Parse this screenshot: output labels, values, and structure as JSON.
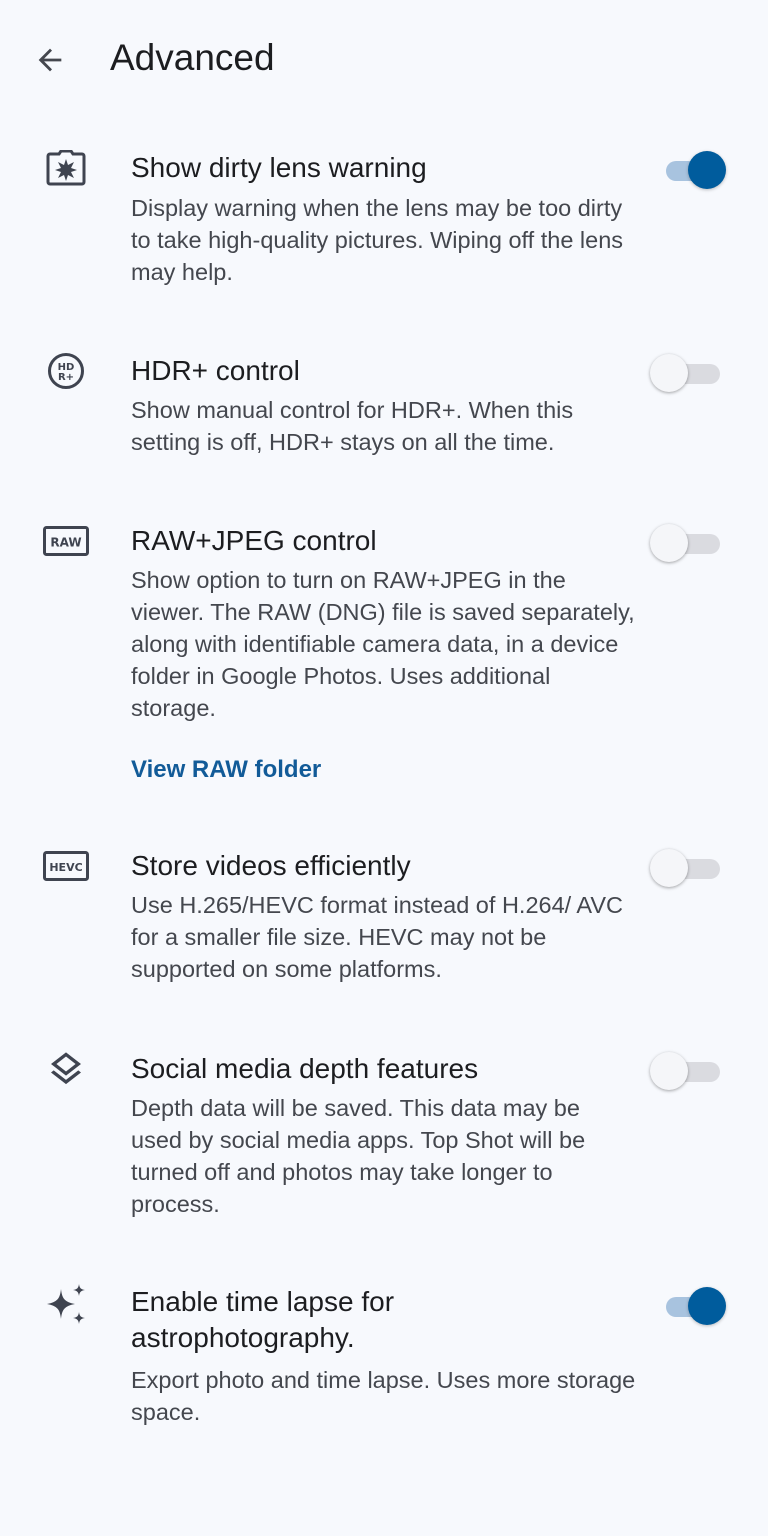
{
  "header": {
    "back_icon": "arrow-back-icon",
    "title": "Advanced"
  },
  "settings": [
    {
      "icon": "dirty-lens-icon",
      "title": "Show dirty lens warning",
      "description": "Display warning when the lens may be too dirty to take high-quality pictures. Wiping off the lens may help.",
      "enabled": true
    },
    {
      "icon": "hdr-plus-icon",
      "title": "HDR+ control",
      "description": "Show manual control for HDR+. When this setting is off, HDR+ stays on all the time.",
      "enabled": false
    },
    {
      "icon": "raw-icon",
      "title": "RAW+JPEG control",
      "description": "Show option to turn on RAW+JPEG in the viewer. The RAW (DNG) file is saved separately, along with identifiable camera data, in a device folder in Google Photos. Uses additional storage.",
      "link": "View RAW folder",
      "enabled": false
    },
    {
      "icon": "hevc-icon",
      "title": "Store videos efficiently",
      "description": "Use H.265/HEVC format instead of H.264/ AVC for a smaller file size. HEVC may not be supported on some platforms.",
      "enabled": false
    },
    {
      "icon": "layers-icon",
      "title": "Social media depth features",
      "description": "Depth data will be saved. This data may be used by social media apps. Top Shot will be turned off and photos may take longer to process.",
      "enabled": false
    },
    {
      "icon": "sparkle-icon",
      "title": "Enable time lapse for astrophotography.",
      "description": "Export photo and time lapse. Uses more storage space.",
      "enabled": true
    }
  ],
  "colors": {
    "background": "#f7f9fd",
    "accent": "#005c9d",
    "link": "#125b98",
    "secondary_text": "#44474e"
  }
}
